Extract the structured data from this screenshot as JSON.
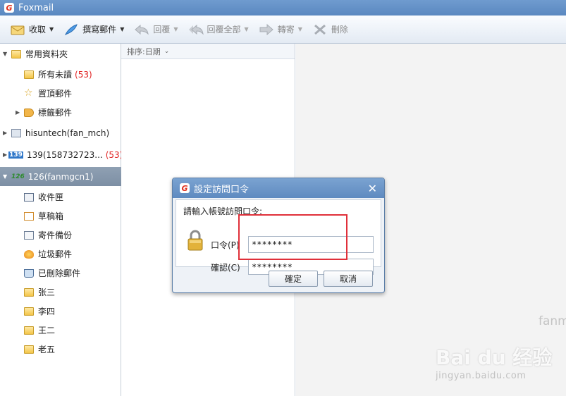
{
  "app": {
    "title": "Foxmail",
    "logo_glyph": "G"
  },
  "toolbar": {
    "receive": "收取",
    "compose": "撰寫郵件",
    "reply": "回覆",
    "reply_all": "回覆全部",
    "forward": "轉寄",
    "delete": "刪除"
  },
  "sidebar": {
    "common": {
      "label": "常用資料夾"
    },
    "all_unread": {
      "label": "所有未讀",
      "count": "(53)"
    },
    "starred": {
      "label": "置頂郵件"
    },
    "tags": {
      "label": "標籤郵件"
    },
    "account1": {
      "label": "hisuntech(fan_mch)"
    },
    "account2": {
      "label": "139(158732723...",
      "count": "(53)",
      "badge": "139"
    },
    "account3": {
      "label": "126(fanmgcn1)",
      "badge": "126"
    },
    "inbox": {
      "label": "收件匣"
    },
    "drafts": {
      "label": "草稿箱"
    },
    "sent": {
      "label": "寄件備份"
    },
    "junk": {
      "label": "垃圾郵件"
    },
    "trash": {
      "label": "已刪除郵件"
    },
    "custom": [
      "张三",
      "李四",
      "王二",
      "老五"
    ]
  },
  "list": {
    "sort_label": "排序:日期"
  },
  "read": {
    "hint": "fanm"
  },
  "watermark": {
    "big": "Bai du 经验",
    "small": "jingyan.baidu.com"
  },
  "dialog": {
    "title": "設定訪問口令",
    "prompt": "請輸入帳號訪問口令:",
    "password_label": "口令(P)",
    "confirm_label": "確認(C)",
    "password_value": "********",
    "confirm_value": "********",
    "ok": "確定",
    "cancel": "取消"
  },
  "colors": {
    "accent": "#5e8ac0",
    "selected": "#7d8fa4",
    "highlight": "#e0303a",
    "unread": "#e02020"
  }
}
